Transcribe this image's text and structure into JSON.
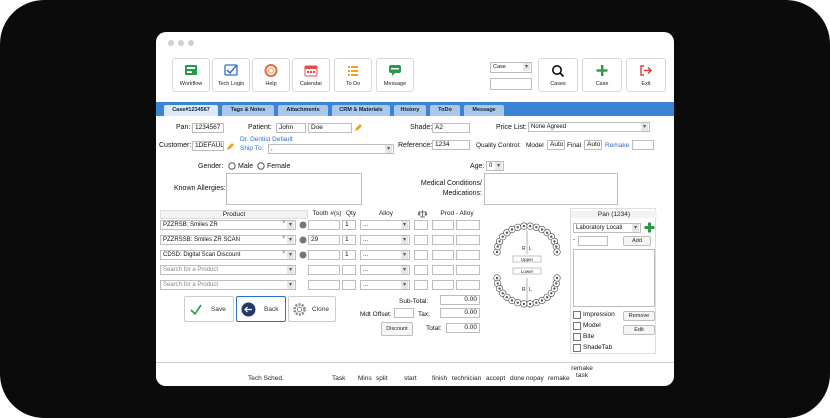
{
  "toolbar": {
    "workflow": "Workflow",
    "tech_login": "Tech Login",
    "help": "Help",
    "calendar": "Calendar",
    "todo": "To Do",
    "message": "Message",
    "case_select": "Case",
    "cases": "Cases",
    "case": "Case",
    "exit": "Exit"
  },
  "tabs": [
    "Case#1234567",
    "Tags & Notes",
    "Attachments",
    "CRM & Materials",
    "History",
    "ToDo",
    "Message"
  ],
  "form": {
    "pan_label": "Pan:",
    "pan_value": "1234567",
    "patient_label": "Patient:",
    "patient_first": "John",
    "patient_last": "Doe",
    "shade_label": "Shade:",
    "shade_value": "A2",
    "price_list_label": "Price List:",
    "price_list_value": "None Agreed",
    "customer_label": "Customer:",
    "customer_value": "1DEFAULT",
    "dentist_link": "Dr. Dentist Default",
    "ship_to_label": "Ship To:",
    "ship_to_value": ",",
    "reference_label": "Reference:",
    "reference_value": "1234",
    "qc_label": "Quality Control:",
    "model_label": "Model",
    "model_value": "Auto",
    "final_label": "Final",
    "final_value": "Auto",
    "remake_label": "Remake",
    "gender_label": "Gender:",
    "male": "Male",
    "female": "Female",
    "age_label": "Age:",
    "age_value": "0",
    "allergies_label": "Known Allergies:",
    "medical_label": "Medical Conditions/",
    "medications_label": "Medications:"
  },
  "products": {
    "headers": [
      "Product",
      "Tooth #(s)",
      "Qty",
      "Alloy",
      "Prod - Alloy"
    ],
    "rows": [
      {
        "product": "PZZRSB: Smiles ZR",
        "tooth": "",
        "qty": "1",
        "alloy": "..."
      },
      {
        "product": "PZZRSSB: Smiles ZR SCAN",
        "tooth": "29",
        "qty": "1",
        "alloy": "..."
      },
      {
        "product": "CDSD: Digital Scan Discount",
        "tooth": "",
        "qty": "1",
        "alloy": "..."
      },
      {
        "product": "Search for a Product",
        "tooth": "",
        "qty": "",
        "alloy": "..."
      },
      {
        "product": "Search for a Product",
        "tooth": "",
        "qty": "",
        "alloy": "..."
      }
    ],
    "save": "Save",
    "back": "Back",
    "clone": "Clone",
    "subtotal_label": "Sub-Total:",
    "subtotal_value": "0.00",
    "mdt_offset_label": "Mdt Offset:",
    "tax_label": "Tax:",
    "tax_value": "0.00",
    "discount": "Discount",
    "total_label": "Total:",
    "total_value": "0.00"
  },
  "chart": {
    "upper": "Upper",
    "lower": "Lower",
    "r": "R",
    "l": "L"
  },
  "pan_panel": {
    "title": "Pan (1234)",
    "location": "Laboratory Locati",
    "dash": "-",
    "add": "Add",
    "impression": "Impression",
    "model": "Model",
    "bite": "Bite",
    "shadetab": "ShadeTab",
    "remove": "Remove",
    "edit": "Edit"
  },
  "bottom": {
    "cols": [
      "Tech Sched.",
      "Task",
      "Mins",
      "split",
      "start",
      "finish",
      "technician",
      "accept",
      "done",
      "nopay",
      "remake"
    ],
    "remake_task": "remake task"
  }
}
